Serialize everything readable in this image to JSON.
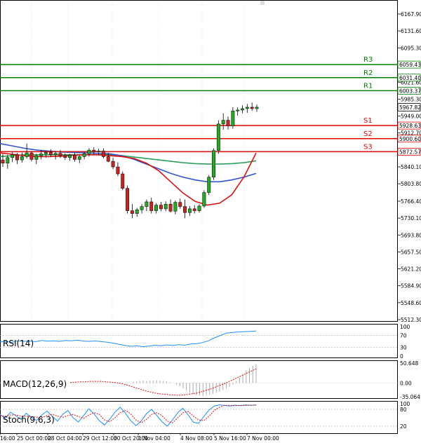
{
  "chart_data": {
    "type": "candlestick",
    "main": {
      "y_ticks": [
        "6167.90",
        "6131.60",
        "6095.30",
        "6021.60",
        "5985.30",
        "5949.00",
        "5912.70",
        "5840.10",
        "5803.80",
        "5766.40",
        "5730.10",
        "5693.80",
        "5657.50",
        "5621.20",
        "5584.90",
        "5548.60",
        "5512.30"
      ],
      "y_range": [
        5512.3,
        6185
      ],
      "current_price": {
        "value": 5967.82,
        "label": "5967.82"
      },
      "levels": [
        {
          "name": "R3",
          "label": "6059.43",
          "value": 6059.43,
          "color": "#008000"
        },
        {
          "name": "R2",
          "label": "6031.40",
          "value": 6031.4,
          "color": "#008000"
        },
        {
          "name": "R1",
          "label": "6003.37",
          "value": 6003.37,
          "color": "#008000"
        },
        {
          "name": "S1",
          "label": "5928.63",
          "value": 5928.63,
          "color": "#e00000"
        },
        {
          "name": "S2",
          "label": "5900.60",
          "value": 5900.6,
          "color": "#e00000"
        },
        {
          "name": "S3",
          "label": "5872.57",
          "value": 5872.57,
          "color": "#e00000"
        }
      ],
      "candles": [
        [
          5855,
          5868,
          5840,
          5848
        ],
        [
          5848,
          5866,
          5836,
          5860
        ],
        [
          5860,
          5873,
          5850,
          5866
        ],
        [
          5866,
          5870,
          5846,
          5855
        ],
        [
          5855,
          5871,
          5849,
          5862
        ],
        [
          5862,
          5890,
          5858,
          5870
        ],
        [
          5870,
          5874,
          5852,
          5856
        ],
        [
          5856,
          5868,
          5846,
          5864
        ],
        [
          5864,
          5876,
          5856,
          5868
        ],
        [
          5868,
          5874,
          5860,
          5871
        ],
        [
          5871,
          5878,
          5861,
          5866
        ],
        [
          5866,
          5874,
          5856,
          5869
        ],
        [
          5869,
          5876,
          5859,
          5864
        ],
        [
          5864,
          5869,
          5855,
          5860
        ],
        [
          5860,
          5868,
          5853,
          5865
        ],
        [
          5865,
          5870,
          5851,
          5856
        ],
        [
          5856,
          5866,
          5848,
          5862
        ],
        [
          5862,
          5872,
          5856,
          5868
        ],
        [
          5868,
          5880,
          5862,
          5876
        ],
        [
          5876,
          5882,
          5866,
          5872
        ],
        [
          5872,
          5879,
          5865,
          5874
        ],
        [
          5874,
          5880,
          5858,
          5862
        ],
        [
          5862,
          5870,
          5850,
          5852
        ],
        [
          5852,
          5860,
          5835,
          5840
        ],
        [
          5840,
          5850,
          5820,
          5825
        ],
        [
          5825,
          5830,
          5790,
          5794
        ],
        [
          5794,
          5800,
          5740,
          5746
        ],
        [
          5746,
          5760,
          5730,
          5740
        ],
        [
          5740,
          5752,
          5733,
          5748
        ],
        [
          5748,
          5760,
          5740,
          5755
        ],
        [
          5755,
          5770,
          5745,
          5765
        ],
        [
          5765,
          5774,
          5740,
          5746
        ],
        [
          5746,
          5762,
          5740,
          5758
        ],
        [
          5758,
          5765,
          5745,
          5750
        ],
        [
          5750,
          5766,
          5745,
          5760
        ],
        [
          5760,
          5770,
          5742,
          5745
        ],
        [
          5745,
          5768,
          5738,
          5764
        ],
        [
          5764,
          5772,
          5750,
          5755
        ],
        [
          5755,
          5770,
          5730,
          5742
        ],
        [
          5742,
          5756,
          5735,
          5750
        ],
        [
          5750,
          5758,
          5740,
          5746
        ],
        [
          5746,
          5760,
          5742,
          5756
        ],
        [
          5756,
          5790,
          5752,
          5785
        ],
        [
          5785,
          5822,
          5780,
          5818
        ],
        [
          5818,
          5880,
          5812,
          5875
        ],
        [
          5875,
          5940,
          5868,
          5932
        ],
        [
          5932,
          5955,
          5920,
          5940
        ],
        [
          5940,
          5948,
          5920,
          5928
        ],
        [
          5928,
          5968,
          5922,
          5960
        ],
        [
          5960,
          5968,
          5950,
          5962
        ],
        [
          5962,
          5972,
          5955,
          5965
        ],
        [
          5965,
          5975,
          5956,
          5968
        ],
        [
          5968,
          5978,
          5960,
          5965
        ],
        [
          5965,
          5974,
          5958,
          5968
        ]
      ],
      "ma_red": [
        5870,
        5867,
        5864,
        5862,
        5862,
        5863,
        5865,
        5866,
        5866,
        5864,
        5862,
        5858,
        5848,
        5832,
        5808,
        5784,
        5766,
        5758,
        5762,
        5780,
        5818,
        5870
      ],
      "ma_blue": [
        5890,
        5885,
        5880,
        5876,
        5874,
        5872,
        5871,
        5870,
        5869,
        5868,
        5864,
        5856,
        5846,
        5836,
        5826,
        5818,
        5812,
        5808,
        5808,
        5812,
        5818,
        5826
      ],
      "ma_green": [
        5862,
        5864,
        5866,
        5866,
        5866,
        5866,
        5866,
        5866,
        5866,
        5866,
        5864,
        5861,
        5858,
        5855,
        5852,
        5849,
        5847,
        5846,
        5846,
        5847,
        5849,
        5853
      ]
    },
    "x_labels": [
      "16:00",
      "25 Oct 00:00",
      "28 Oct 04:00",
      "29 Oct 12:00",
      "30 Oct 20:00",
      "1 Nov 04:00",
      "4 Nov 08:00",
      "5 Nov 16:00",
      "7 Nov 00:00"
    ],
    "rsi": {
      "label": "RSI(14)",
      "ticks": [
        "100",
        "70",
        "30",
        "0"
      ],
      "levels": [
        100,
        70,
        30,
        0
      ],
      "values": [
        48,
        49,
        47,
        52,
        50,
        51,
        49,
        53,
        51,
        52,
        50,
        53,
        52,
        54,
        51,
        50,
        52,
        49,
        47,
        44,
        40,
        36,
        33,
        35,
        32,
        34,
        37,
        35,
        38,
        36,
        39,
        37,
        41,
        42,
        46,
        52,
        62,
        70,
        78,
        80,
        82,
        83,
        84,
        85
      ]
    },
    "macd": {
      "label": "MACD(12,26,9)",
      "ticks": [
        "50.648",
        "0.00",
        "-35.064"
      ],
      "range": [
        -35.064,
        50.648
      ],
      "histogram": [
        3,
        4,
        5,
        6,
        5,
        6,
        6,
        7,
        6,
        5,
        4,
        2,
        0,
        -4,
        -8,
        -14,
        -20,
        -25,
        -29,
        -31,
        -32,
        -33,
        -32,
        -30,
        -28,
        -25,
        -22,
        -18,
        -14,
        -10,
        -4,
        5,
        14,
        24,
        32,
        38,
        44,
        48
      ],
      "signal": [
        1,
        2,
        3,
        3,
        4,
        4,
        4,
        3,
        2,
        1,
        -1,
        -4,
        -8,
        -12,
        -16,
        -20,
        -23,
        -26,
        -28,
        -29,
        -30,
        -31,
        -31,
        -30,
        -28,
        -26,
        -23,
        -19,
        -15,
        -10,
        -5,
        0,
        6,
        12,
        18,
        24,
        30,
        36
      ]
    },
    "stoch": {
      "label": "Stoch(9,6,3)",
      "ticks": [
        "100",
        "80",
        "20"
      ],
      "levels": [
        100,
        80,
        20
      ],
      "k": [
        62,
        48,
        70,
        58,
        44,
        66,
        52,
        40,
        60,
        74,
        55,
        38,
        62,
        76,
        50,
        35,
        58,
        82,
        64,
        40,
        24,
        45,
        70,
        88,
        66,
        40,
        22,
        38,
        64,
        80,
        58,
        36,
        20,
        42,
        68,
        84,
        60,
        34,
        30,
        55,
        78,
        92,
        96,
        94,
        92,
        95,
        93,
        96,
        94,
        96
      ],
      "d": [
        58,
        55,
        60,
        60,
        56,
        56,
        54,
        52,
        50,
        58,
        62,
        56,
        52,
        58,
        62,
        54,
        48,
        60,
        68,
        62,
        42,
        36,
        50,
        68,
        76,
        64,
        42,
        32,
        44,
        62,
        68,
        58,
        38,
        32,
        50,
        68,
        72,
        56,
        42,
        40,
        56,
        76,
        88,
        94,
        94,
        93,
        94,
        94,
        95,
        95
      ]
    }
  }
}
